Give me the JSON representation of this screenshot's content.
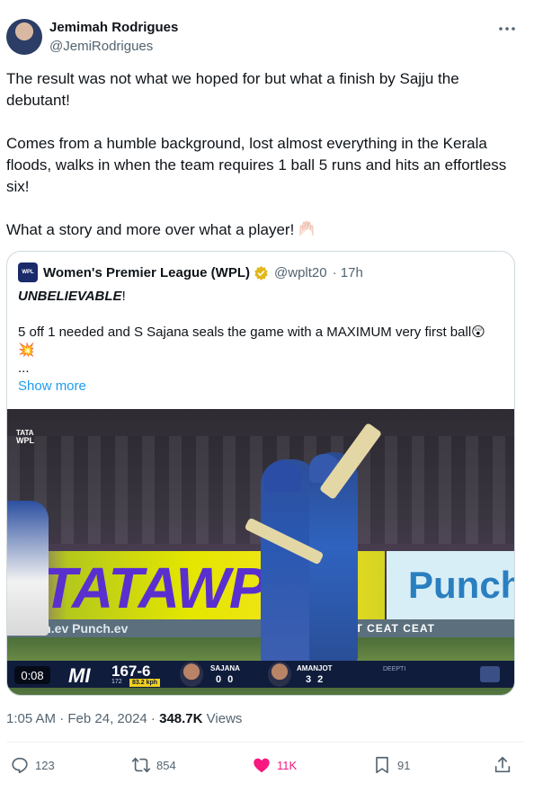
{
  "author": {
    "name": "Jemimah Rodrigues",
    "handle": "@JemiRodrigues"
  },
  "tweet": {
    "paragraphs": [
      "The result was not what we hoped for but what a finish by Sajju the debutant!",
      "Comes from a humble background, lost almost everything in the Kerala floods, walks in when the team requires 1 ball 5 runs and hits an effortless six!",
      "What a story and more over what a player!"
    ],
    "emoji": "raising-hands-icon"
  },
  "quote": {
    "name": "Women's Premier League (WPL)",
    "handle": "@wplt20",
    "time": "· 17h",
    "avatar_text": "WPL",
    "line1_emphasis": "UNBELIEVABLE",
    "line1_rest": "!",
    "line2": "5 off 1 needed and S Sajana seals the game with a MAXIMUM very first ball😲",
    "line2_emoji": "💥",
    "ellipsis": "...",
    "show_more": "Show more"
  },
  "video": {
    "logo_top": "TATA",
    "logo_bottom": "WPL",
    "hoarding": "#TATAWPL",
    "board": "Punch",
    "ad_strip": "Punch.ev Punch.ev",
    "ceat_strip": "CEAT CEAT CEAT",
    "duration": "0:08",
    "team": "MI",
    "score": "167-6",
    "overs": "172",
    "speed": "83.2 kph",
    "batter1": {
      "name": "SAJANA",
      "score": "0 0"
    },
    "batter2": {
      "name": "AMANJOT",
      "score": "3 2"
    },
    "bowler": "DEEPTI"
  },
  "meta": {
    "time": "1:05 AM · Feb 24, 2024 ·",
    "views_count": "348.7K",
    "views_label": "Views"
  },
  "actions": {
    "replies": "123",
    "retweets": "854",
    "likes": "11K",
    "bookmarks": "91"
  },
  "colors": {
    "accent": "#1d9bf0",
    "like": "#f91880",
    "secondary_text": "#536471",
    "verified_gold": "#e2b719"
  }
}
